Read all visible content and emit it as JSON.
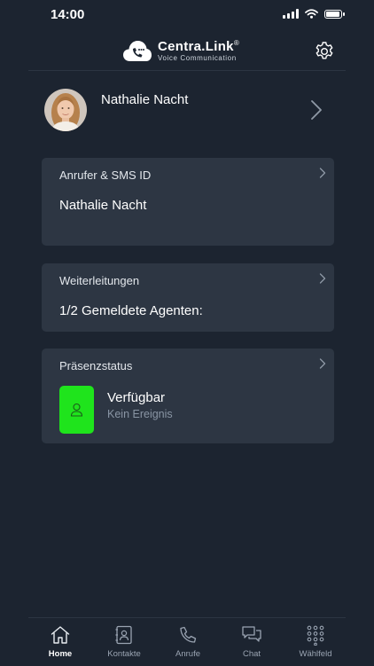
{
  "status_bar": {
    "time": "14:00"
  },
  "header": {
    "brand": "Centra.Link",
    "registered": "®",
    "tagline": "Voice Communication"
  },
  "profile": {
    "name": "Nathalie Nacht"
  },
  "cards": {
    "caller_id": {
      "title": "Anrufer & SMS ID",
      "value": "Nathalie Nacht"
    },
    "forwarding": {
      "title": "Weiterleitungen",
      "value": "1/2 Gemeldete Agenten:"
    },
    "presence": {
      "title": "Präsenzstatus",
      "status": "Verfügbar",
      "event": "Kein Ereignis",
      "status_color": "#1fe41c"
    }
  },
  "tabs": [
    {
      "label": "Home",
      "icon": "home-icon",
      "active": true
    },
    {
      "label": "Kontakte",
      "icon": "contacts-icon",
      "active": false
    },
    {
      "label": "Anrufe",
      "icon": "phone-icon",
      "active": false
    },
    {
      "label": "Chat",
      "icon": "chat-icon",
      "active": false
    },
    {
      "label": "Wählfeld",
      "icon": "dialpad-icon",
      "active": false
    }
  ],
  "colors": {
    "background": "#1c2430",
    "card": "#2d3643",
    "presence_available": "#1fe41c"
  }
}
